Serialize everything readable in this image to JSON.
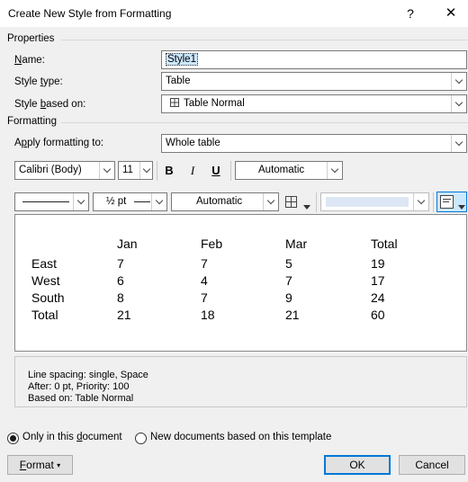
{
  "window": {
    "title": "Create New Style from Formatting",
    "help": "?",
    "close": "✕"
  },
  "properties": {
    "section": "Properties",
    "name_label": "Name:",
    "name_value": "Style1",
    "type_label": "Style type:",
    "type_value": "Table",
    "based_label": "Style based on:",
    "based_value": "Table Normal"
  },
  "formatting": {
    "section": "Formatting",
    "apply_label": "Apply formatting to:",
    "apply_value": "Whole table",
    "font": "Calibri (Body)",
    "size": "11",
    "bold": "B",
    "italic": "I",
    "underline": "U",
    "font_color": "Automatic",
    "border_weight": "½ pt",
    "border_color": "Automatic"
  },
  "preview_table": {
    "header": [
      "",
      "Jan",
      "Feb",
      "Mar",
      "Total"
    ],
    "rows": [
      [
        "East",
        "7",
        "7",
        "5",
        "19"
      ],
      [
        "West",
        "6",
        "4",
        "7",
        "17"
      ],
      [
        "South",
        "8",
        "7",
        "9",
        "24"
      ],
      [
        "Total",
        "21",
        "18",
        "21",
        "60"
      ]
    ]
  },
  "description": {
    "line1": "Line spacing:  single, Space",
    "line2": "After:  0 pt, Priority: 100",
    "line3": "Based on: Table Normal"
  },
  "options": {
    "only_doc": "Only in this document",
    "new_docs": "New documents based on this template",
    "selected": "only_doc"
  },
  "buttons": {
    "format": "Format",
    "ok": "OK",
    "cancel": "Cancel"
  },
  "colors": {
    "accent": "#0078d7",
    "selection": "#cce8ff",
    "fill_swatch": "#dce6f4"
  }
}
